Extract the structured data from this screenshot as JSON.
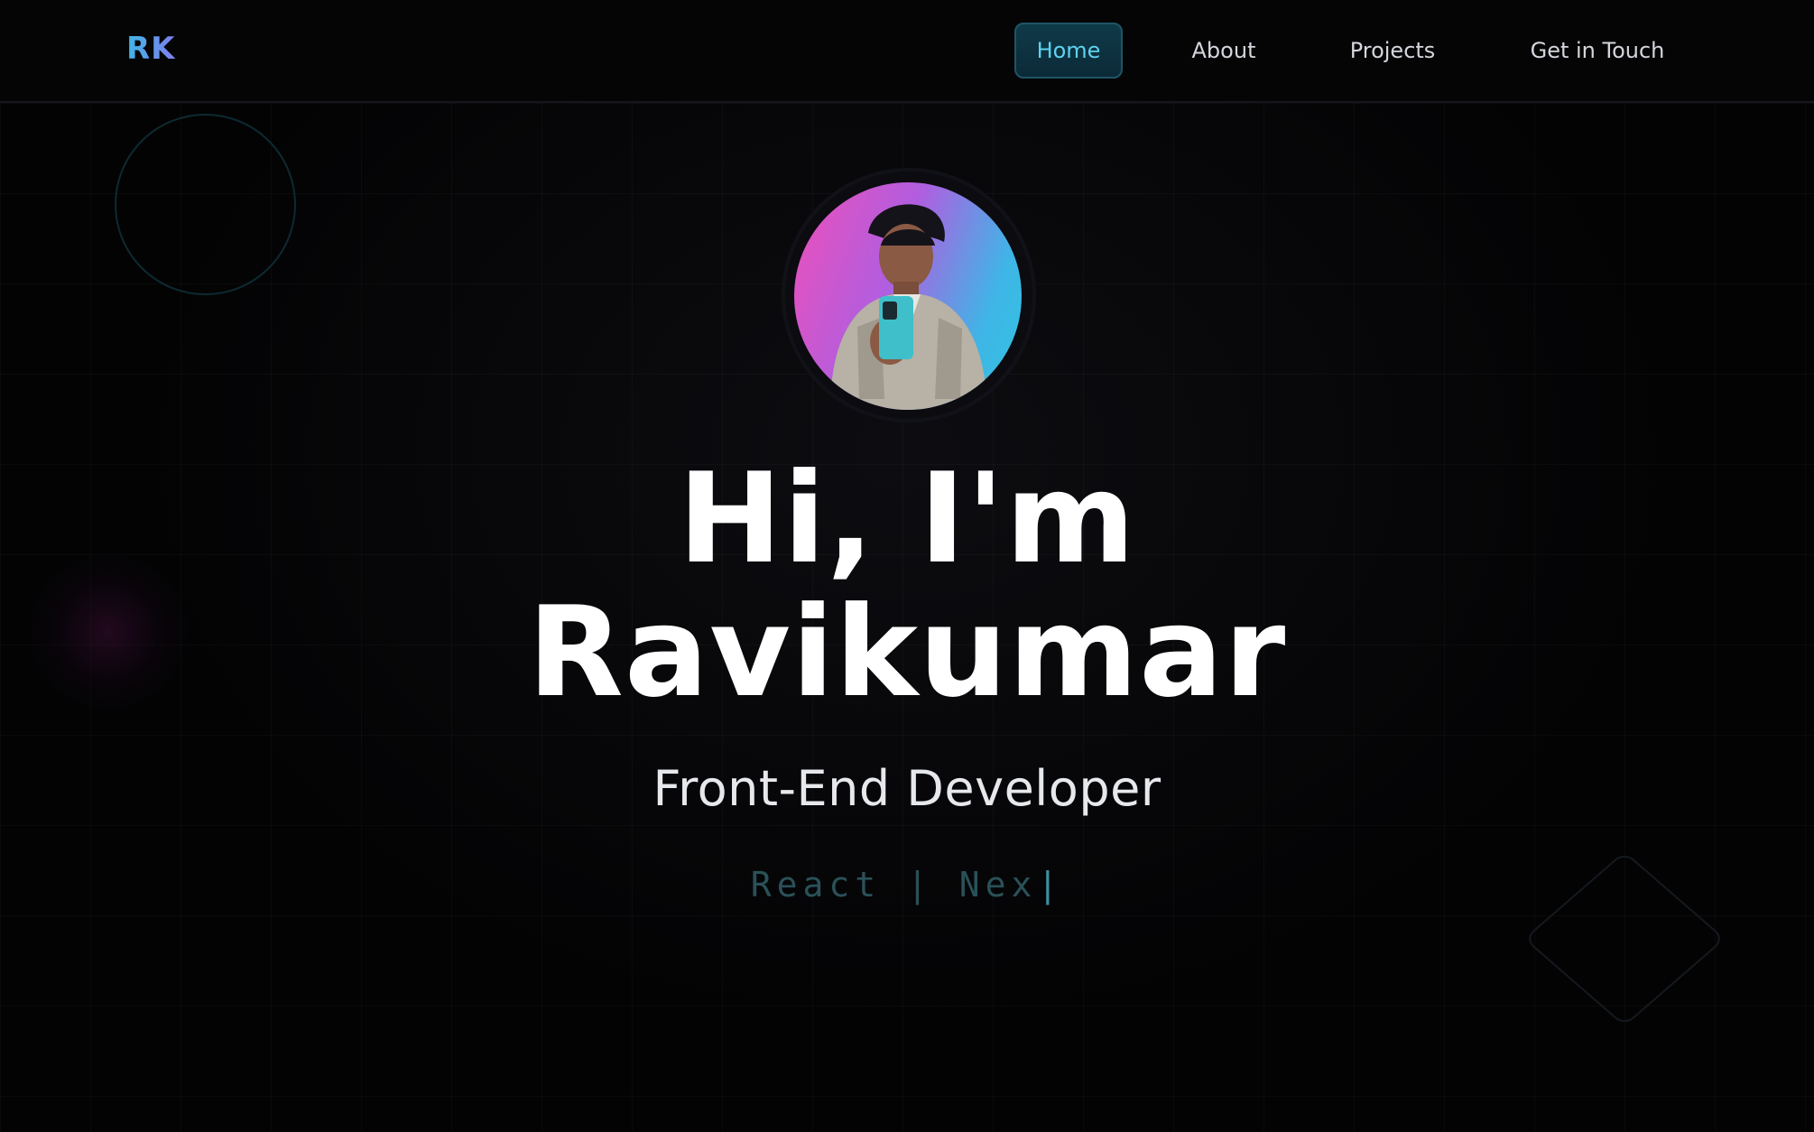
{
  "header": {
    "logo": "RK",
    "nav": [
      {
        "label": "Home",
        "active": true
      },
      {
        "label": "About",
        "active": false
      },
      {
        "label": "Projects",
        "active": false
      },
      {
        "label": "Get in Touch",
        "active": false
      }
    ]
  },
  "hero": {
    "greeting_line1": "Hi, I'm",
    "greeting_line2": "Ravikumar",
    "role": "Front-End Developer",
    "tech_typing": "React | Nex",
    "cursor": "|"
  },
  "colors": {
    "background": "#030304",
    "accent_cyan": "#5fd2ef",
    "accent_pink": "#ee4fb9",
    "logo_gradient_start": "#3fb6e6",
    "logo_gradient_end": "#7f7ef0",
    "typing_text": "#2a5158"
  },
  "icons": {
    "avatar": "profile-photo"
  }
}
